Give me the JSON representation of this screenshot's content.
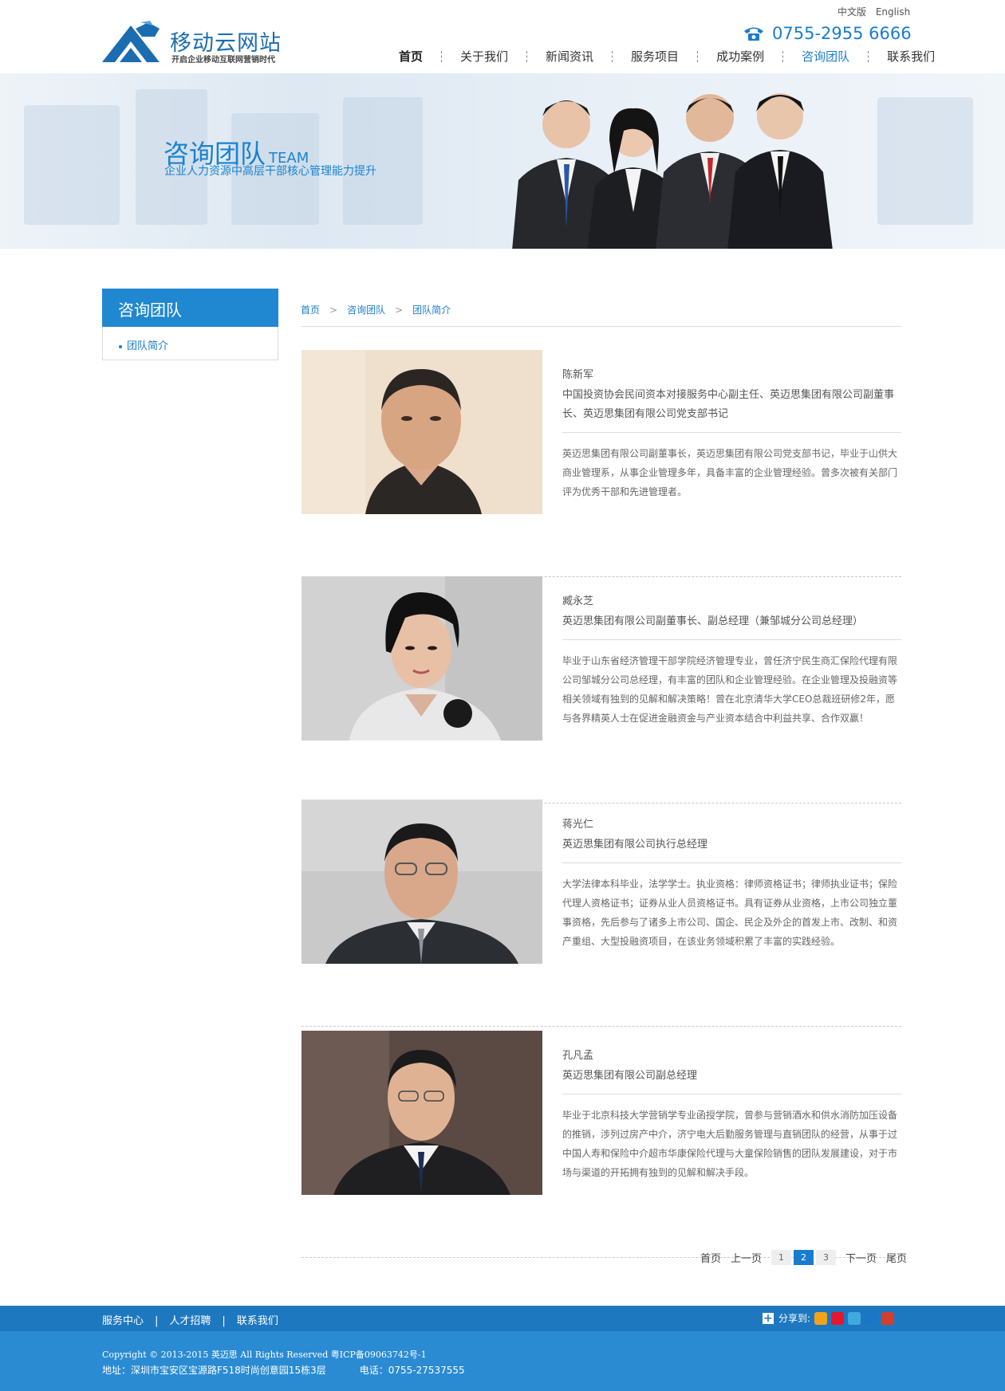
{
  "header": {
    "logo_text": "移动云网站",
    "logo_slogan": "开启企业移动互联网营销时代",
    "lang_cn": "中文版",
    "lang_en": "English",
    "phone": "0755-2955 6666",
    "nav": [
      {
        "label": "首页"
      },
      {
        "label": "关于我们"
      },
      {
        "label": "新闻资讯"
      },
      {
        "label": "服务项目"
      },
      {
        "label": "成功案例"
      },
      {
        "label": "咨询团队"
      },
      {
        "label": "联系我们"
      }
    ]
  },
  "banner": {
    "title": "咨询团队",
    "title_en": "TEAM",
    "subtitle": "企业人力资源中高层干部核心管理能力提升"
  },
  "sidebar": {
    "title": "咨询团队",
    "items": [
      {
        "label": "团队简介"
      }
    ]
  },
  "breadcrumb": [
    "首页",
    "咨询团队",
    "团队简介"
  ],
  "breadcrumb_sep": ">",
  "members": [
    {
      "name": "陈新军",
      "role": "中国投资协会民间资本对接服务中心副主任、英迈思集团有限公司副董事长、英迈思集团有限公司党支部书记",
      "bio": "英迈思集团有限公司副董事长，英迈思集团有限公司党支部书记，毕业于山供大商业管理系，从事企业管理多年，具备丰富的企业管理经验。曾多次被有关部门评为优秀干部和先进管理者。"
    },
    {
      "name": "臧永芝",
      "role": "英迈思集团有限公司副董事长、副总经理（兼邹城分公司总经理）",
      "bio": "毕业于山东省经济管理干部学院经济管理专业，曾任济宁民生商汇保险代理有限公司邹城分公司总经理，有丰富的团队和企业管理经验。在企业管理及投融资等相关领域有独到的见解和解决策略！曾在北京清华大学CEO总裁班研修2年，愿与各界精英人士在促进金融资金与产业资本结合中利益共享、合作双赢！"
    },
    {
      "name": "蒋光仁",
      "role": "英迈思集团有限公司执行总经理",
      "bio": "大学法律本科毕业，法学学士。执业资格：律师资格证书；律师执业证书；保险代理人资格证书；证券从业人员资格证书。具有证券从业资格，上市公司独立董事资格，先后参与了诸多上市公司、国企、民企及外企的首发上市、改制、和资产重组、大型投融资项目，在该业务领域积累了丰富的实践经验。"
    },
    {
      "name": "孔凡孟",
      "role": "英迈思集团有限公司副总经理",
      "bio": "毕业于北京科技大学营销学专业函授学院，曾参与营销酒水和供水消防加压设备的推销，涉列过房产中介，济宁电大后勤服务管理与直销团队的经营，从事于过中国人寿和保险中介超市华康保险代理与大童保险销售的团队发展建设，对于市场与渠道的开拓拥有独到的见解和解决手段。"
    }
  ],
  "pager": {
    "first": "首页",
    "prev": "上一页",
    "pages": [
      "1",
      "2",
      "3"
    ],
    "current": "2",
    "next": "下一页",
    "last": "尾页"
  },
  "footer": {
    "links": [
      "服务中心",
      "人才招聘",
      "联系我们"
    ],
    "link_sep": "|",
    "share_label": "分享到:",
    "share_colors": [
      "#f2a31b",
      "#e6162d",
      "#3fa9e0",
      "#1b76c8",
      "#d33f2e"
    ],
    "copyright": "Copyright © 2013-2015 英迈思 All Rights Reserved 粤ICP备09063742号-1",
    "address": "地址：深圳市宝安区宝源路F518时尚创意园15栋3层",
    "tel": "电话：0755-27537555"
  }
}
